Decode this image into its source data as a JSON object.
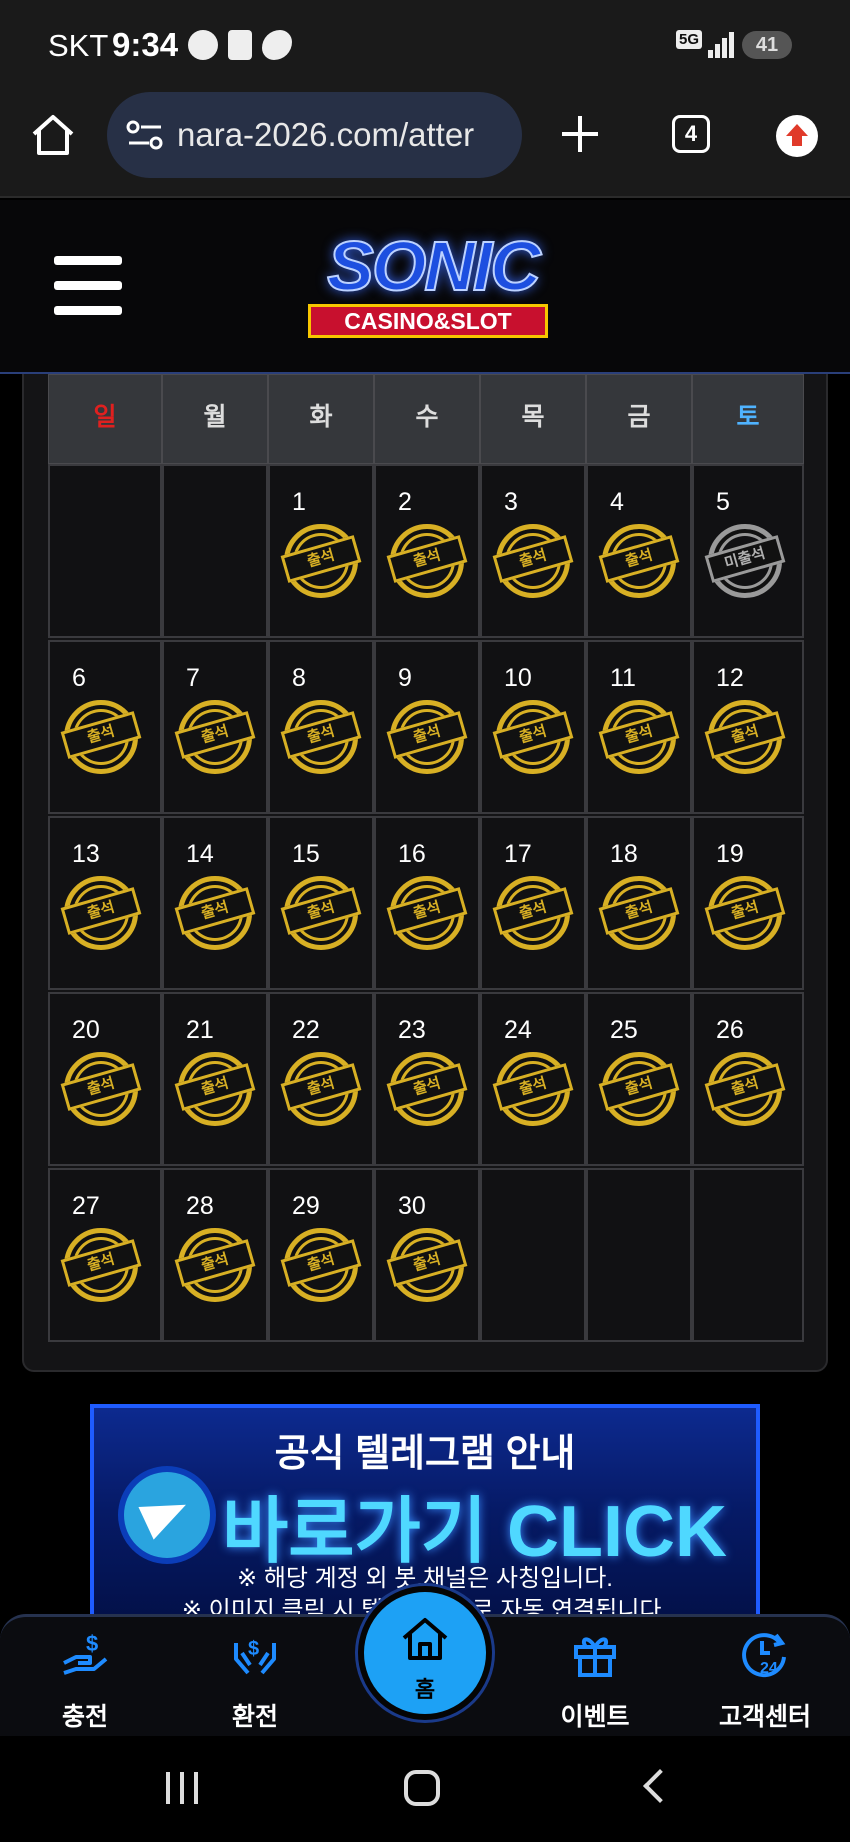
{
  "status_bar": {
    "carrier": "SKT",
    "time": "9:34",
    "network": "5G",
    "battery": "41"
  },
  "browser": {
    "url": "nara-2026.com/atter",
    "tab_count": "4"
  },
  "site": {
    "logo_title": "SONIC",
    "logo_subtitle": "CASINO&SLOT"
  },
  "calendar": {
    "weekdays": [
      "일",
      "월",
      "화",
      "수",
      "목",
      "금",
      "토"
    ],
    "weekday_colors": [
      "#e0201f",
      "#dddddd",
      "#dddddd",
      "#dddddd",
      "#dddddd",
      "#dddddd",
      "#4fb3ff"
    ],
    "stamp_attended": "출석",
    "stamp_missed": "미출석",
    "weeks": [
      [
        null,
        null,
        {
          "day": "1",
          "status": "attended"
        },
        {
          "day": "2",
          "status": "attended"
        },
        {
          "day": "3",
          "status": "attended"
        },
        {
          "day": "4",
          "status": "attended"
        },
        {
          "day": "5",
          "status": "missed"
        }
      ],
      [
        {
          "day": "6",
          "status": "attended"
        },
        {
          "day": "7",
          "status": "attended"
        },
        {
          "day": "8",
          "status": "attended"
        },
        {
          "day": "9",
          "status": "attended"
        },
        {
          "day": "10",
          "status": "attended"
        },
        {
          "day": "11",
          "status": "attended"
        },
        {
          "day": "12",
          "status": "attended"
        }
      ],
      [
        {
          "day": "13",
          "status": "attended"
        },
        {
          "day": "14",
          "status": "attended"
        },
        {
          "day": "15",
          "status": "attended"
        },
        {
          "day": "16",
          "status": "attended"
        },
        {
          "day": "17",
          "status": "attended"
        },
        {
          "day": "18",
          "status": "attended"
        },
        {
          "day": "19",
          "status": "attended"
        }
      ],
      [
        {
          "day": "20",
          "status": "attended"
        },
        {
          "day": "21",
          "status": "attended"
        },
        {
          "day": "22",
          "status": "attended"
        },
        {
          "day": "23",
          "status": "attended"
        },
        {
          "day": "24",
          "status": "attended"
        },
        {
          "day": "25",
          "status": "attended"
        },
        {
          "day": "26",
          "status": "attended"
        }
      ],
      [
        {
          "day": "27",
          "status": "attended"
        },
        {
          "day": "28",
          "status": "attended"
        },
        {
          "day": "29",
          "status": "attended"
        },
        {
          "day": "30",
          "status": "attended"
        },
        null,
        null,
        null
      ]
    ]
  },
  "banner": {
    "title": "공식 텔레그램 안내",
    "cta": "바로가기 CLICK",
    "note1": "※ 해당 계정 외 봇,채널은 사칭입니다.",
    "note2": "※ 이미지 클릭 시 텔레그램으로 자동 연결됩니다."
  },
  "bottom_nav": {
    "items": [
      {
        "label": "충전",
        "icon": "deposit-icon"
      },
      {
        "label": "환전",
        "icon": "exchange-icon"
      },
      {
        "label": "홈",
        "icon": "home-icon"
      },
      {
        "label": "이벤트",
        "icon": "gift-icon"
      },
      {
        "label": "고객센터",
        "icon": "support-24-icon"
      }
    ]
  }
}
